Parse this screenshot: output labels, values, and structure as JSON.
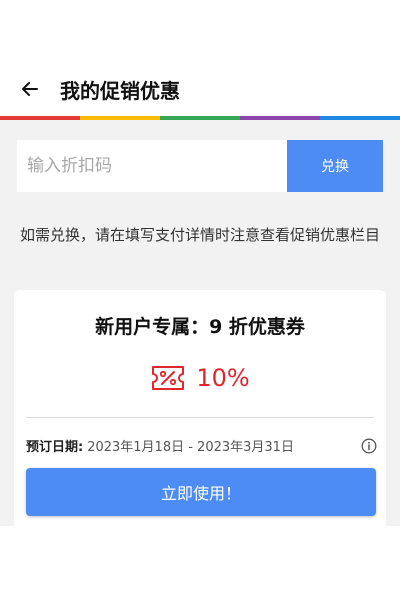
{
  "header": {
    "back_icon": "arrow-left-icon",
    "title": "我的促销优惠"
  },
  "brand_stripe": {
    "colors": [
      "#e53935",
      "#fbbc05",
      "#34a853",
      "#8e44ad",
      "#1e88e5"
    ]
  },
  "promo": {
    "placeholder": "输入折扣码",
    "value": "",
    "redeem_label": "兑换"
  },
  "hint": "如需兑换，请在填写支付详情时注意查看促销优惠栏目",
  "coupon": {
    "title": "新用户专属：9 折优惠券",
    "icon": "discount-coupon-icon",
    "discount": "10%",
    "date_label": "预订日期:",
    "date_range": "2023年1月18日 - 2023年3月31日",
    "info_icon": "info-icon",
    "use_label": "立即使用！"
  },
  "colors": {
    "accent_blue": "#4d8cf5",
    "discount_red": "#e0262a",
    "content_bg": "#f2f2f2"
  }
}
